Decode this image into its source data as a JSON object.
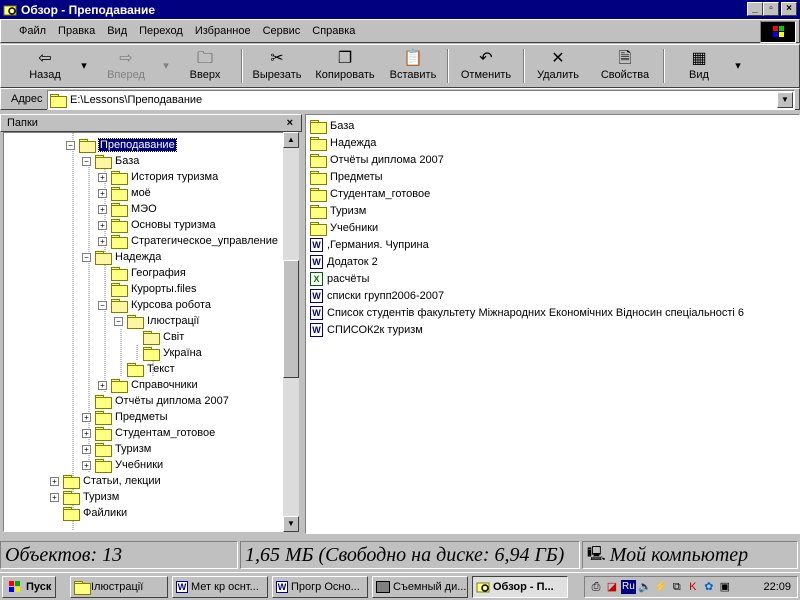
{
  "window": {
    "title": "Обзор - Преподавание",
    "minimize": "_",
    "maximize": "▫",
    "close": "×"
  },
  "menu": [
    {
      "label": "Файл"
    },
    {
      "label": "Правка"
    },
    {
      "label": "Вид"
    },
    {
      "label": "Переход"
    },
    {
      "label": "Избранное"
    },
    {
      "label": "Сервис"
    },
    {
      "label": "Справка"
    }
  ],
  "toolbar": {
    "back": "Назад",
    "forward": "Вперед",
    "up": "Вверх",
    "cut": "Вырезать",
    "copy": "Копировать",
    "paste": "Вставить",
    "undo": "Отменить",
    "delete": "Удалить",
    "properties": "Свойства",
    "view": "Вид"
  },
  "address": {
    "label": "Адрес",
    "value": "E:\\Lessons\\Преподавание"
  },
  "folders_panel": {
    "title": "Папки",
    "close": "×"
  },
  "tree": [
    {
      "label": "Преподавание",
      "selected": true
    },
    {
      "label": "База"
    },
    {
      "label": "История туризма"
    },
    {
      "label": "моё"
    },
    {
      "label": "МЭО"
    },
    {
      "label": "Основы туризма"
    },
    {
      "label": "Стратегическое_управление"
    },
    {
      "label": "Надежда"
    },
    {
      "label": "География"
    },
    {
      "label": "Курорты.files"
    },
    {
      "label": "Курсова робота"
    },
    {
      "label": "Ілюстрації"
    },
    {
      "label": "Світ"
    },
    {
      "label": "Україна"
    },
    {
      "label": "Текст"
    },
    {
      "label": "Справочники"
    },
    {
      "label": "Отчёты диплома 2007"
    },
    {
      "label": "Предметы"
    },
    {
      "label": "Студентам_готовое"
    },
    {
      "label": "Туризм"
    },
    {
      "label": "Учебники"
    },
    {
      "label": "Статьи, лекции"
    },
    {
      "label": "Туризм"
    },
    {
      "label": "Файлики"
    }
  ],
  "files": [
    {
      "name": "База",
      "type": "folder"
    },
    {
      "name": "Надежда",
      "type": "folder"
    },
    {
      "name": "Отчёты диплома 2007",
      "type": "folder"
    },
    {
      "name": "Предметы",
      "type": "folder"
    },
    {
      "name": "Студентам_готовое",
      "type": "folder"
    },
    {
      "name": "Туризм",
      "type": "folder"
    },
    {
      "name": "Учебники",
      "type": "folder"
    },
    {
      "name": ",Германия. Чуприна",
      "type": "word"
    },
    {
      "name": "Додаток 2",
      "type": "word"
    },
    {
      "name": "расчёты",
      "type": "excel"
    },
    {
      "name": "списки групп2006-2007",
      "type": "word"
    },
    {
      "name": "Список студентів факультету Міжнародних Економічних Відносин спеціальності 6",
      "type": "word"
    },
    {
      "name": "СПИСОК2к туризм",
      "type": "word"
    }
  ],
  "status": {
    "objects": "Объектов: 13",
    "size": "1,65 МБ (Свободно на диске: 6,94 ГБ)",
    "location": "Мой компьютер"
  },
  "taskbar": {
    "start": "Пуск",
    "tasks": [
      {
        "label": "Ілюстрації"
      },
      {
        "label": "Мет кр оснт..."
      },
      {
        "label": "Прогр Осно..."
      },
      {
        "label": "Съемный ди..."
      },
      {
        "label": "Обзор - П..."
      }
    ],
    "lang": "Ru",
    "clock": "22:09"
  },
  "colors": {
    "titlebar": "#000080",
    "face": "#c0c0c0",
    "selection": "#000080"
  }
}
